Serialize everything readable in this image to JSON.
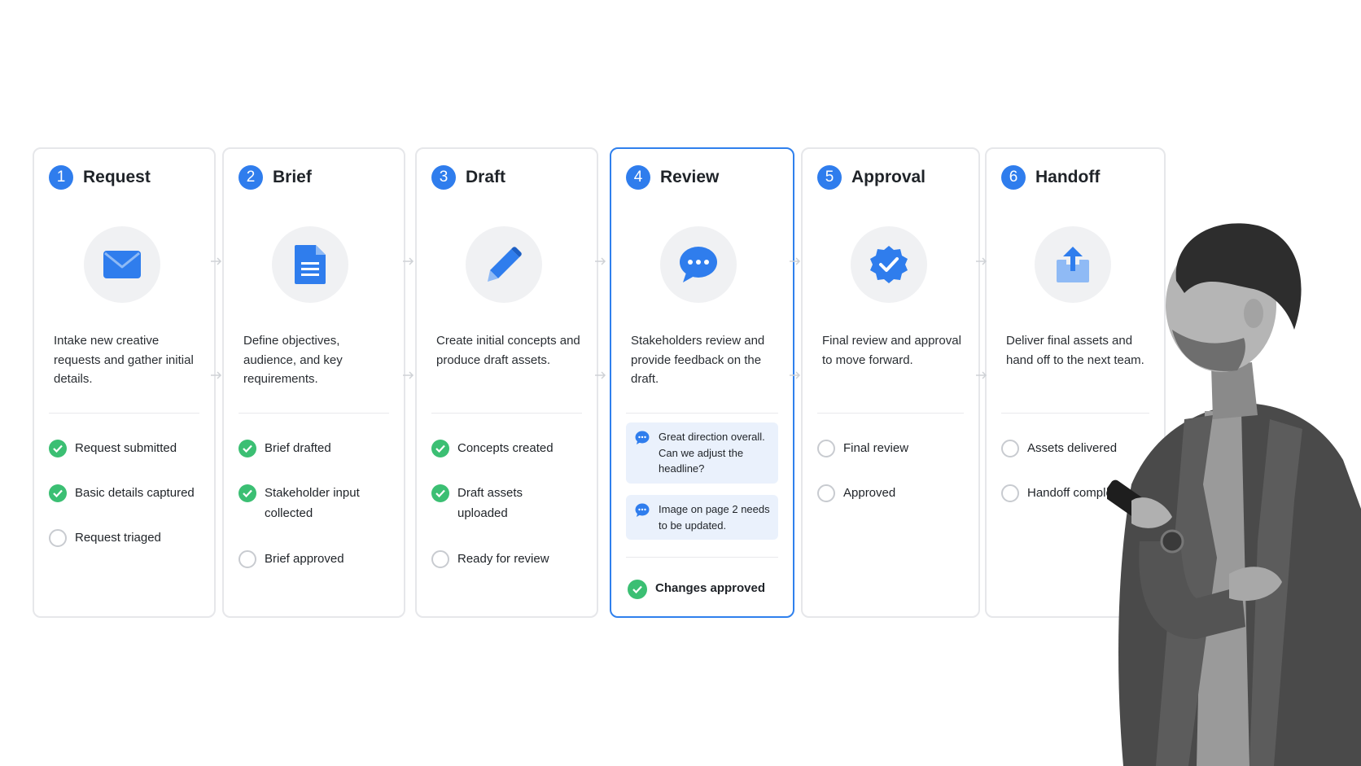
{
  "accent_color": "#2f7ded",
  "done_color": "#3bbf73",
  "steps": [
    {
      "number": "1",
      "title": "Request",
      "icon": "envelope-icon",
      "description": "Intake new creative requests and gather initial details.",
      "checklist": [
        {
          "label": "Request submitted",
          "done": true
        },
        {
          "label": "Basic details captured",
          "done": true
        },
        {
          "label": "Request triaged",
          "done": false
        }
      ]
    },
    {
      "number": "2",
      "title": "Brief",
      "icon": "document-icon",
      "description": "Define objectives, audience, and key requirements.",
      "checklist": [
        {
          "label": "Brief drafted",
          "done": true
        },
        {
          "label": "Stakeholder input collected",
          "done": true
        },
        {
          "label": "Brief approved",
          "done": false
        }
      ]
    },
    {
      "number": "3",
      "title": "Draft",
      "icon": "pencil-icon",
      "description": "Create initial concepts and produce draft assets.",
      "checklist": [
        {
          "label": "Concepts created",
          "done": true
        },
        {
          "label": "Draft assets uploaded",
          "done": true
        },
        {
          "label": "Ready for review",
          "done": false
        }
      ]
    },
    {
      "number": "4",
      "title": "Review",
      "icon": "chat-bubble-icon",
      "active": true,
      "description": "Stakeholders review and provide feedback on the draft.",
      "comments": [
        {
          "text": "Great direction overall. Can we adjust the headline?"
        },
        {
          "text": "Image on page 2 needs to be updated."
        }
      ],
      "checklist": [
        {
          "label": "Changes approved",
          "done": true
        }
      ]
    },
    {
      "number": "5",
      "title": "Approval",
      "icon": "verified-badge-icon",
      "description": "Final review and approval to move forward.",
      "checklist": [
        {
          "label": "Final review",
          "done": false
        },
        {
          "label": "Approved",
          "done": false
        }
      ]
    },
    {
      "number": "6",
      "title": "Handoff",
      "icon": "upload-icon",
      "description": "Deliver final assets and hand off to the next team.",
      "checklist": [
        {
          "label": "Assets delivered",
          "done": false
        },
        {
          "label": "Handoff complete",
          "done": false
        }
      ]
    }
  ]
}
